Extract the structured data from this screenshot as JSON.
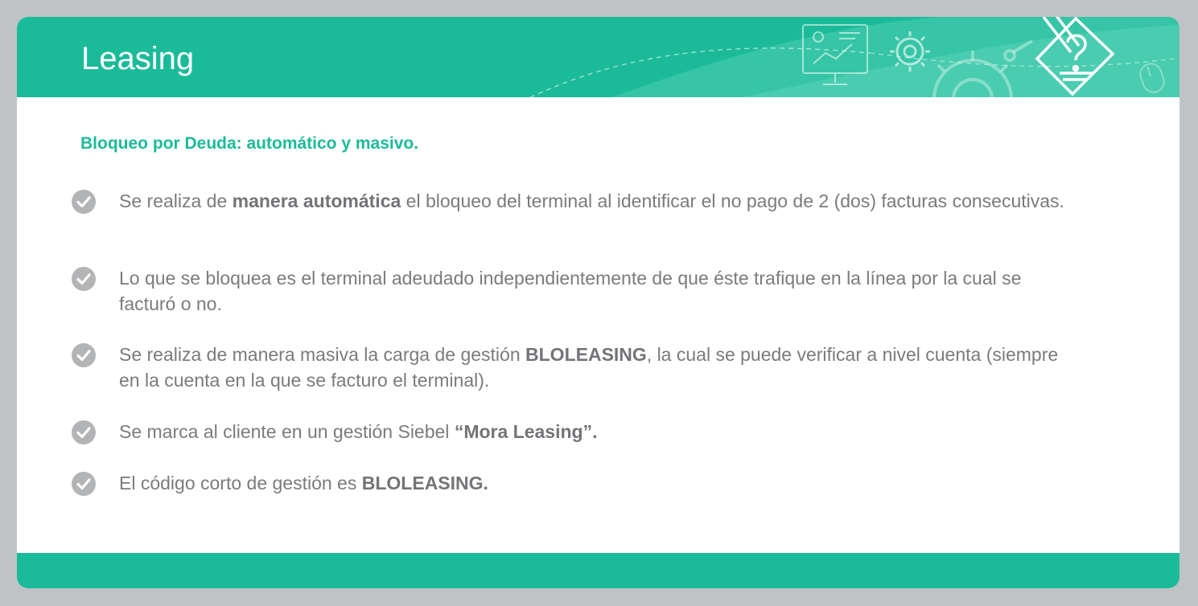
{
  "slide": {
    "title": "Leasing",
    "subtitle": "Bloqueo por Deuda: automático y masivo.",
    "bullets": [
      {
        "parts": [
          {
            "text": "Se realiza de ",
            "bold": false
          },
          {
            "text": "manera automática",
            "bold": true
          },
          {
            "text": " el bloqueo del terminal al identificar el no pago de 2 (dos) facturas consecutivas.",
            "bold": false
          }
        ]
      },
      {
        "parts": [
          {
            "text": "Lo que se bloquea es el terminal adeudado independientemente de que éste trafique en la línea por la cual se facturó o no.",
            "bold": false
          }
        ]
      },
      {
        "parts": [
          {
            "text": "Se realiza de manera masiva la carga de gestión ",
            "bold": false
          },
          {
            "text": "BLOLEASING",
            "bold": true
          },
          {
            "text": ", la cual se puede verificar a nivel cuenta (siempre en la cuenta en la que se facturo el terminal).",
            "bold": false
          }
        ]
      },
      {
        "parts": [
          {
            "text": "Se marca al cliente en un gestión Siebel  ",
            "bold": false
          },
          {
            "text": "“Mora Leasing”.",
            "bold": true
          }
        ]
      },
      {
        "parts": [
          {
            "text": "El código corto de gestión es ",
            "bold": false
          },
          {
            "text": "BLOLEASING.",
            "bold": true
          }
        ]
      }
    ],
    "header_icons": [
      "presentation-board-icon",
      "gear-icon",
      "large-gear-icon",
      "pencil-question-icon",
      "mouse-icon"
    ]
  },
  "colors": {
    "background": "#bfc3c6",
    "accent": "#1bbb99",
    "text": "#7a7b7d",
    "check_circle": "#b3b4b6"
  }
}
